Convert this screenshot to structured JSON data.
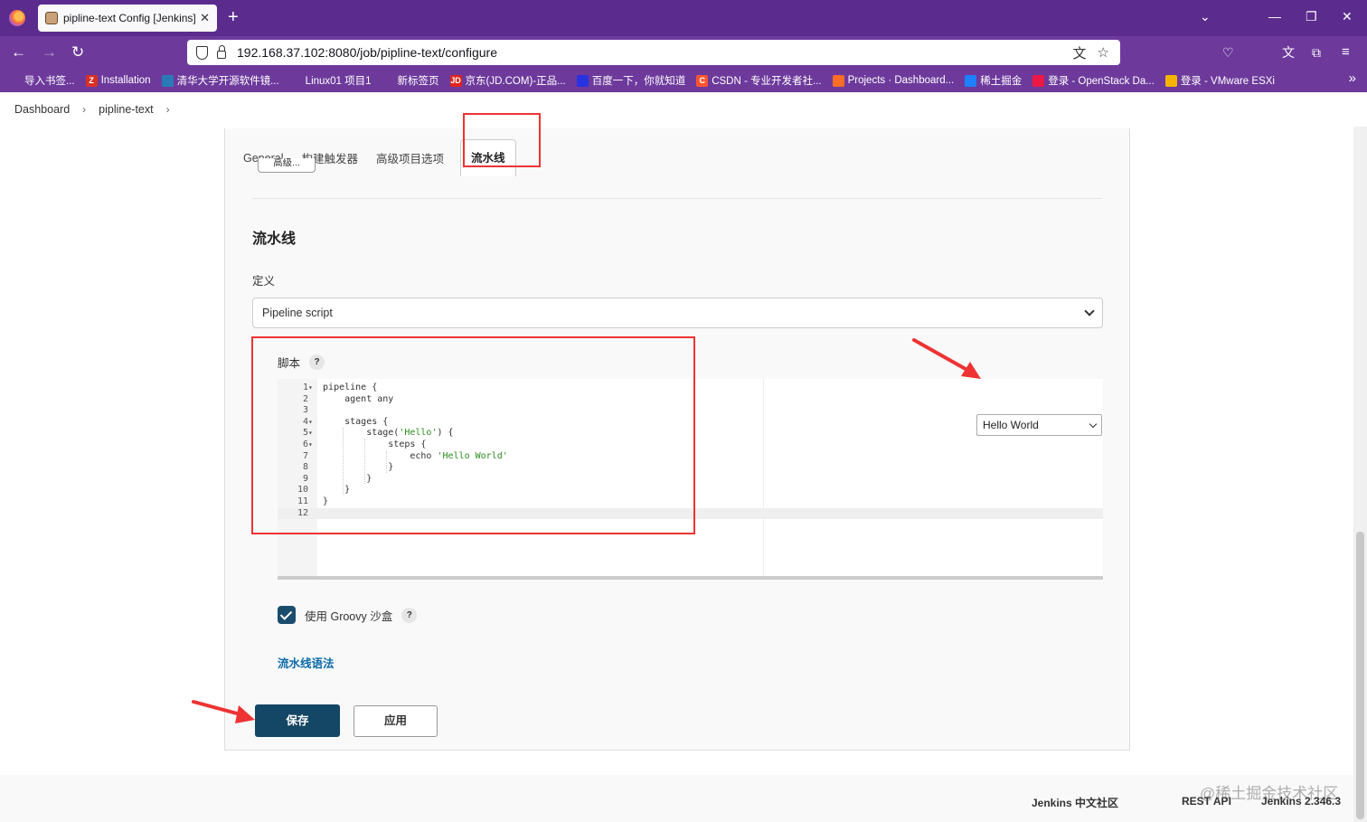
{
  "browser": {
    "tab_title": "pipline-text Config [Jenkins]",
    "tab_close": "✕",
    "new_tab": "+",
    "url": "192.168.37.102:8080/job/pipline-text/configure",
    "bookmarks": [
      {
        "label": "导入书签...",
        "icon": "import-icon",
        "color": "#6d3a9c"
      },
      {
        "label": "Installation",
        "icon": "Z",
        "color": "#d93025"
      },
      {
        "label": "清华大学开源软件镜...",
        "icon": "tsinghua-icon",
        "color": "#2a7ab8"
      },
      {
        "label": "Linux01 项目1",
        "icon": "globe-icon",
        "color": "#6d3a9c"
      },
      {
        "label": "新标签页",
        "icon": "globe-icon",
        "color": "#6d3a9c"
      },
      {
        "label": "京东(JD.COM)-正品...",
        "icon": "JD",
        "color": "#e1251b"
      },
      {
        "label": "百度一下，你就知道",
        "icon": "baidu-icon",
        "color": "#2932e1"
      },
      {
        "label": "CSDN - 专业开发者社...",
        "icon": "C",
        "color": "#fc5531"
      },
      {
        "label": "Projects · Dashboard...",
        "icon": "gitlab-icon",
        "color": "#fc6d26"
      },
      {
        "label": "稀土掘金",
        "icon": "juejin-icon",
        "color": "#1e80ff"
      },
      {
        "label": "登录 - OpenStack Da...",
        "icon": "openstack-icon",
        "color": "#ed1944"
      },
      {
        "label": "登录 - VMware ESXi",
        "icon": "vmware-icon",
        "color": "#f4b400"
      }
    ]
  },
  "breadcrumb": [
    "Dashboard",
    "pipline-text"
  ],
  "tabs": [
    "General",
    "构建触发器",
    "高级项目选项",
    "流水线"
  ],
  "advanced_button": "高级...",
  "section_title": "流水线",
  "definition": {
    "label": "定义",
    "value": "Pipeline script"
  },
  "script": {
    "label": "脚本",
    "help": "?",
    "lines": [
      {
        "n": "1",
        "fold": "▾",
        "code": "pipeline {"
      },
      {
        "n": "2",
        "fold": "",
        "code": "    agent any"
      },
      {
        "n": "3",
        "fold": "",
        "code": ""
      },
      {
        "n": "4",
        "fold": "▾",
        "code": "    stages {"
      },
      {
        "n": "5",
        "fold": "▾",
        "code": "        stage(",
        "str": "'Hello'",
        "tail": ") {"
      },
      {
        "n": "6",
        "fold": "▾",
        "code": "            steps {"
      },
      {
        "n": "7",
        "fold": "",
        "code": "                echo ",
        "str": "'Hello World'",
        "tail": ""
      },
      {
        "n": "8",
        "fold": "",
        "code": "            }"
      },
      {
        "n": "9",
        "fold": "",
        "code": "        }"
      },
      {
        "n": "10",
        "fold": "",
        "code": "    }"
      },
      {
        "n": "11",
        "fold": "",
        "code": "}"
      },
      {
        "n": "12",
        "fold": "",
        "code": ""
      }
    ],
    "sample_select": "Hello World"
  },
  "groovy_sandbox": {
    "label": "使用 Groovy 沙盒",
    "checked": true,
    "help": "?"
  },
  "syntax_link": "流水线语法",
  "buttons": {
    "save": "保存",
    "apply": "应用"
  },
  "footer": {
    "community": "Jenkins 中文社区",
    "rest_api": "REST API",
    "version": "Jenkins 2.346.3",
    "watermark": "@稀土掘金技术社区"
  },
  "colors": {
    "browser_bar": "#6d3a9c",
    "save_button": "#144665",
    "highlight": "#e33333",
    "link": "#0b6aa8"
  }
}
